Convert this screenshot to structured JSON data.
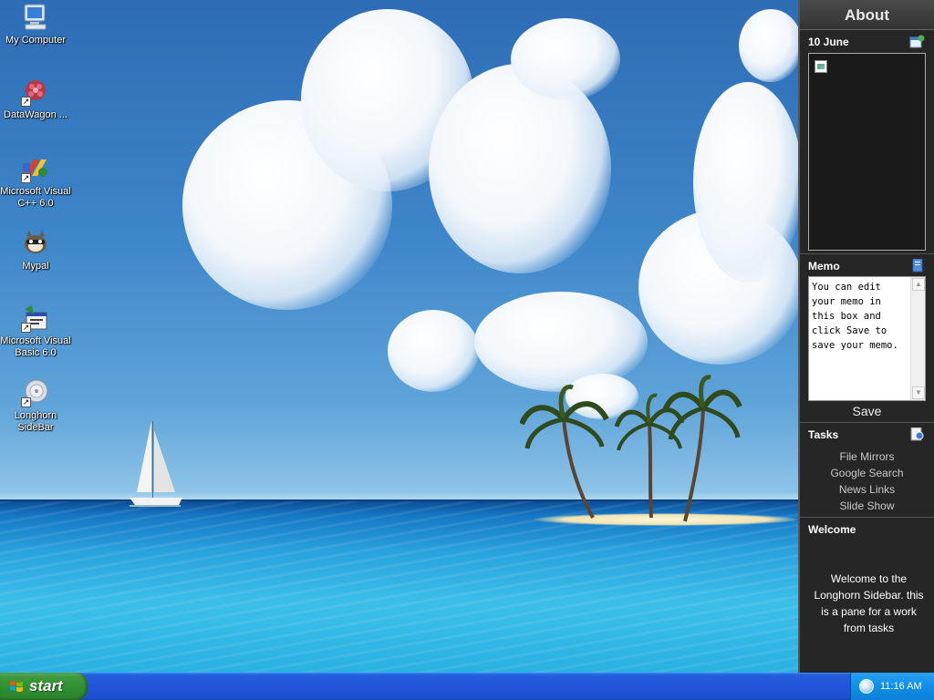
{
  "desktop": {
    "icons": [
      {
        "label": "My Computer",
        "icon": "my-computer-icon"
      },
      {
        "label": "DataWagon ...",
        "icon": "datawagon-icon"
      },
      {
        "label": "Microsoft Visual C++ 6.0",
        "icon": "visual-cpp-icon"
      },
      {
        "label": "Mypal",
        "icon": "mypal-icon"
      },
      {
        "label": "Microsoft Visual Basic 6.0",
        "icon": "visual-basic-icon"
      },
      {
        "label": "Longhorn SideBar",
        "icon": "longhorn-sidebar-icon"
      }
    ]
  },
  "sidebar": {
    "header": "About",
    "calendar": {
      "title": "10 June",
      "icon": "calendar-icon"
    },
    "memo": {
      "title": "Memo",
      "icon": "memo-icon",
      "text": "You can edit your memo in this box and click Save to save your memo.",
      "save_label": "Save"
    },
    "tasks": {
      "title": "Tasks",
      "icon": "tasks-icon",
      "items": [
        "File Mirrors",
        "Google Search",
        "News Links",
        "Slide Show"
      ]
    },
    "welcome": {
      "title": "Welcome",
      "text": "Welcome to the Longhorn Sidebar. this is a pane for a work from tasks"
    }
  },
  "taskbar": {
    "start_label": "start",
    "clock": "11:16 AM",
    "tray_icon": "network-icon"
  }
}
